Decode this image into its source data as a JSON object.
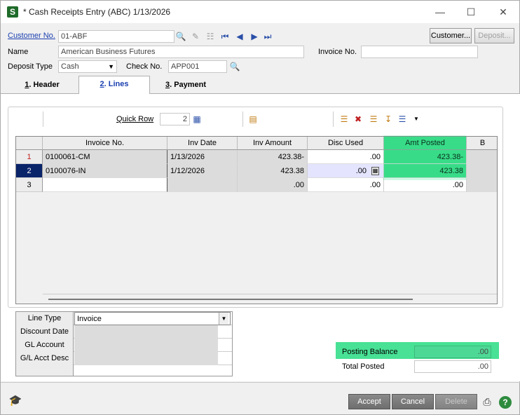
{
  "window": {
    "app_icon": "S",
    "title": "* Cash Receipts Entry (ABC) 1/13/2026"
  },
  "header": {
    "customer_label": "Customer No.",
    "customer_value": "01-ABF",
    "name_label": "Name",
    "name_value": "American Business Futures",
    "invoice_label": "Invoice No.",
    "invoice_value": "",
    "deposit_type_label": "Deposit Type",
    "deposit_type_value": "Cash",
    "check_label": "Check No.",
    "check_value": "APP001",
    "customer_button": "Customer...",
    "deposit_button": "Deposit..."
  },
  "tabs": [
    {
      "key": "1",
      "label": ". Header"
    },
    {
      "key": "2",
      "label": ". Lines"
    },
    {
      "key": "3",
      "label": ". Payment"
    }
  ],
  "lines": {
    "quick_row_label": "Quick Row",
    "quick_row_value": "2",
    "columns": [
      "Invoice No.",
      "Inv Date",
      "Inv Amount",
      "Disc Used",
      "Amt Posted",
      "B"
    ],
    "rows": [
      {
        "num": "1",
        "invoice": "0100061-CM",
        "date": "1/13/2026",
        "amount": "423.38-",
        "disc": ".00",
        "posted": "423.38-"
      },
      {
        "num": "2",
        "invoice": "0100076-IN",
        "date": "1/12/2026",
        "amount": "423.38",
        "disc": ".00",
        "posted": "423.38"
      },
      {
        "num": "3",
        "invoice": "",
        "date": "",
        "amount": ".00",
        "disc": ".00",
        "posted": ".00"
      }
    ]
  },
  "line_details": {
    "line_type_label": "Line Type",
    "line_type_value": "Invoice",
    "discount_date_label": "Discount Date",
    "gl_account_label": "GL Account",
    "gl_desc_label": "G/L Acct Desc"
  },
  "totals": {
    "posting_balance_label": "Posting Balance",
    "posting_balance_value": ".00",
    "total_posted_label": "Total Posted",
    "total_posted_value": ".00"
  },
  "footer": {
    "accept": "Accept",
    "cancel": "Cancel",
    "delete": "Delete"
  },
  "colors": {
    "highlight": "#3ddc8a",
    "link": "#1a3fb0",
    "selected_row": "#0a246a"
  }
}
